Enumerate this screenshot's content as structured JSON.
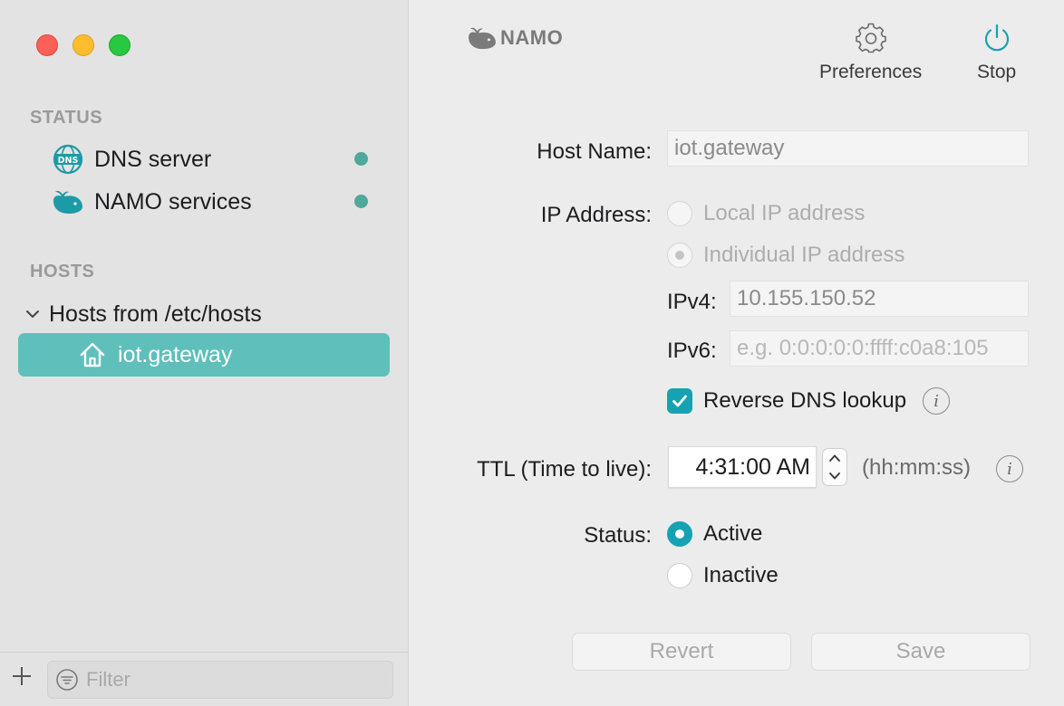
{
  "sidebar": {
    "status_heading": "STATUS",
    "status_items": [
      {
        "label": "DNS server",
        "icon": "dns-globe-icon",
        "state_color": "#4fa99a"
      },
      {
        "label": "NAMO services",
        "icon": "whale-icon",
        "state_color": "#4fa99a"
      }
    ],
    "hosts_heading": "HOSTS",
    "group": {
      "label": "Hosts from /etc/hosts",
      "expanded": true
    },
    "hosts": [
      {
        "label": "iot.gateway",
        "icon": "house-icon",
        "selected": true
      }
    ],
    "filter_placeholder": "Filter",
    "add_icon": "plus-icon"
  },
  "header": {
    "logo_text": "NAMO",
    "preferences_label": "Preferences",
    "stop_label": "Stop"
  },
  "form": {
    "host_name_label": "Host Name:",
    "host_name_value": "iot.gateway",
    "ip_address_label": "IP Address:",
    "ip_option_local": "Local IP address",
    "ip_option_individual": "Individual IP address",
    "ipv4_label": "IPv4:",
    "ipv4_value": "10.155.150.52",
    "ipv6_label": "IPv6:",
    "ipv6_placeholder": "e.g. 0:0:0:0:0:ffff:c0a8:105",
    "reverse_dns_label": "Reverse DNS lookup",
    "reverse_dns_checked": true,
    "ttl_label": "TTL (Time to live):",
    "ttl_value": "4:31:00 AM",
    "ttl_unit": "(hh:mm:ss)",
    "status_label": "Status:",
    "status_active": "Active",
    "status_inactive": "Inactive",
    "status_selected": "Active"
  },
  "actions": {
    "revert_label": "Revert",
    "save_label": "Save"
  },
  "colors": {
    "accent": "#17a2b3",
    "selection": "#5fbfbb",
    "status_dot": "#4fa99a"
  }
}
